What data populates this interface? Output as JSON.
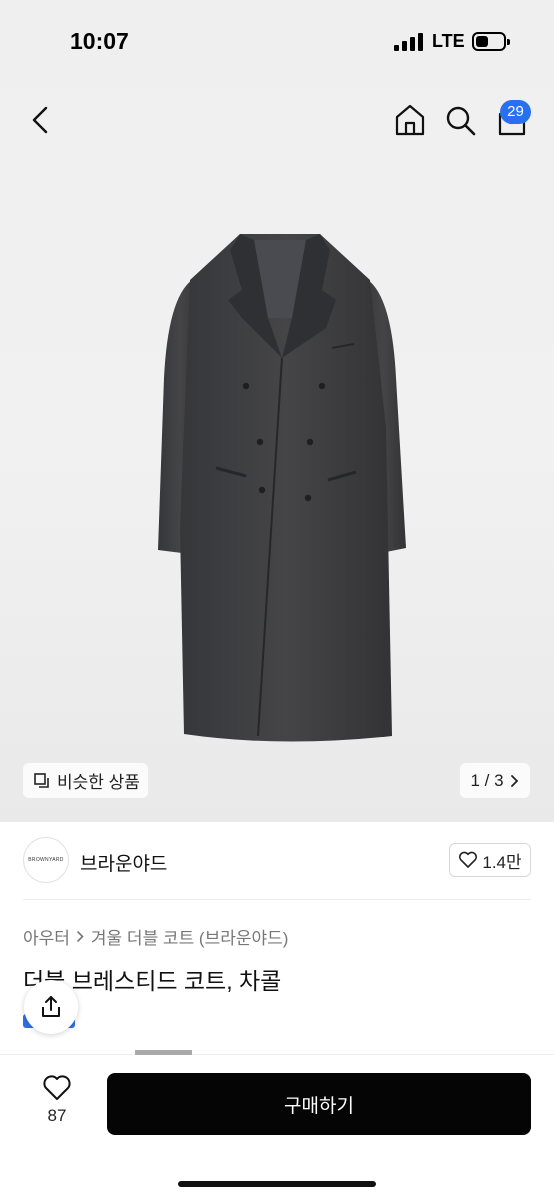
{
  "status_bar": {
    "time": "10:07",
    "network": "LTE"
  },
  "nav": {
    "cart_count": "29"
  },
  "hero": {
    "similar_label": "비슷한 상품",
    "pager": "1 / 3"
  },
  "brand": {
    "logo_text": "BROWNYARD",
    "name": "브라운야드",
    "likes": "1.4만"
  },
  "product": {
    "breadcrumb": [
      "아우터",
      "겨울 더블 코트 (브라운야드)"
    ],
    "title": "더블 브레스티드 코트, 차콜"
  },
  "bottom": {
    "wish_count": "87",
    "buy_label": "구매하기"
  },
  "colors": {
    "accent": "#2a6ff0",
    "buy_bg": "#050505",
    "coat": "#3d3d3f"
  },
  "icons": [
    "back-icon",
    "home-icon",
    "search-icon",
    "cart-icon",
    "copy-icon",
    "chevron-right-icon",
    "heart-icon",
    "share-icon"
  ]
}
